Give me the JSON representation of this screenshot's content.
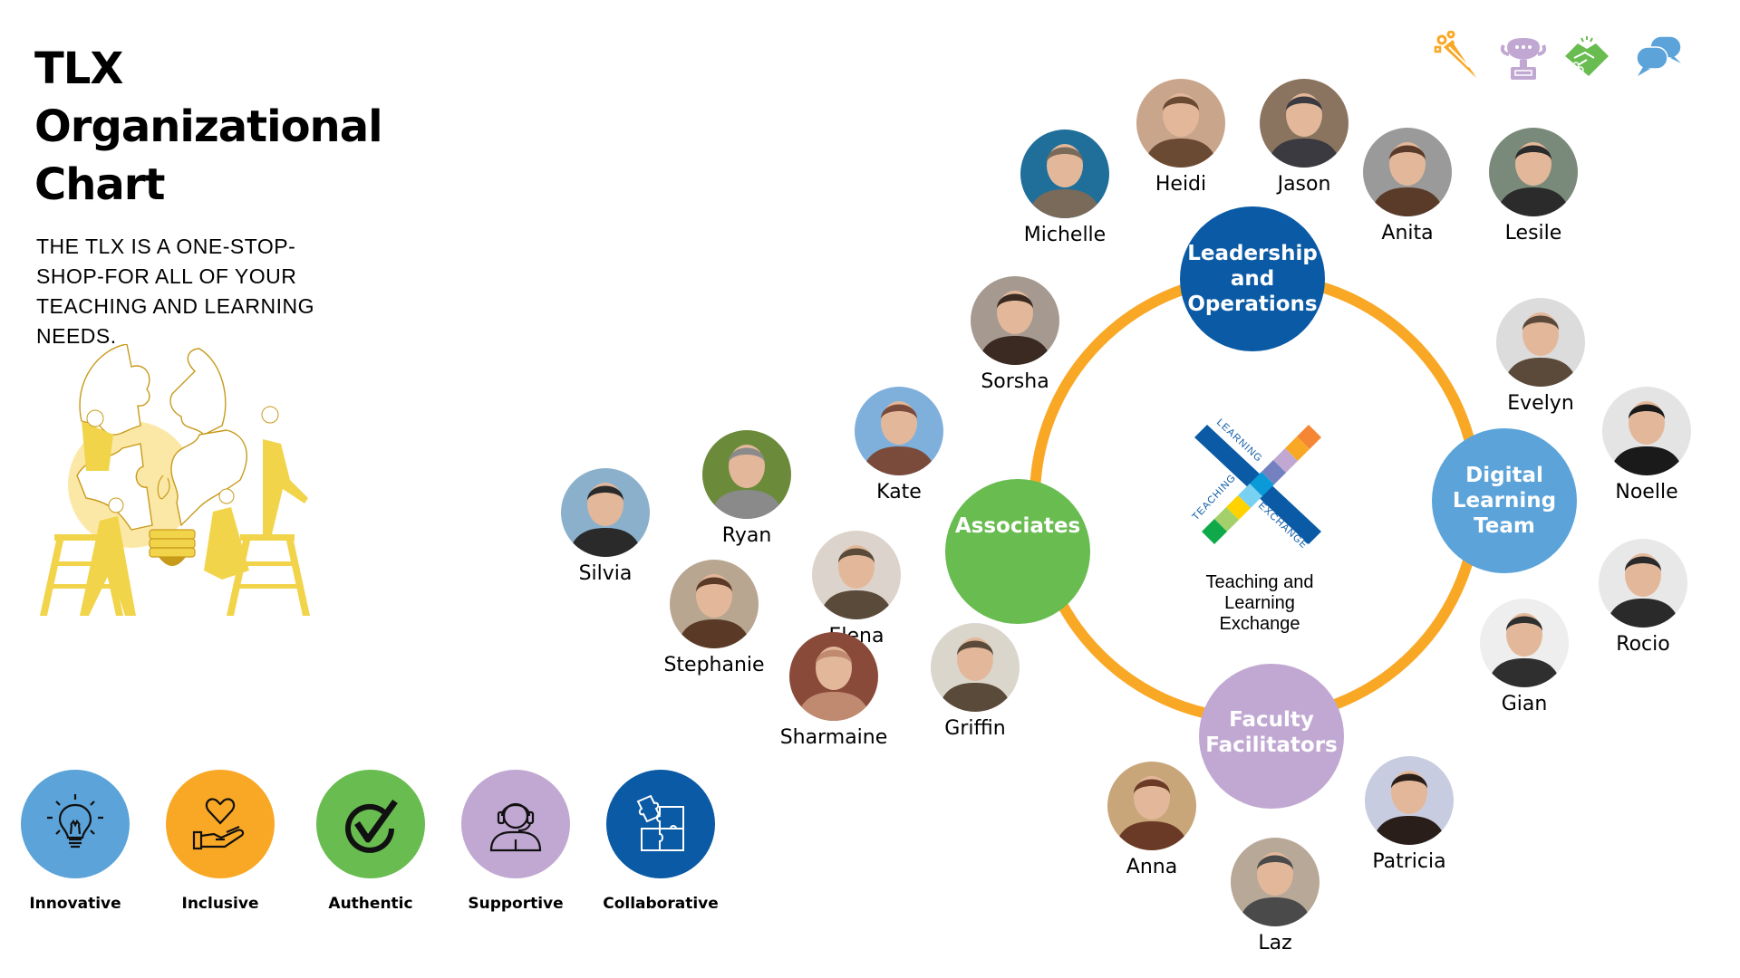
{
  "header": {
    "title_lines": [
      "TLX",
      "Organizational",
      "Chart"
    ],
    "tagline": "THE TLX IS A ONE-STOP-SHOP-FOR ALL OF YOUR TEACHING AND LEARNING NEEDS."
  },
  "top_icons": [
    {
      "name": "party-popper-icon",
      "color": "#F9A826"
    },
    {
      "name": "trophy-icon",
      "color": "#C1A8D2"
    },
    {
      "name": "handshake-icon",
      "color": "#68BC50"
    },
    {
      "name": "chat-bubbles-icon",
      "color": "#5BA3D9"
    }
  ],
  "center": {
    "logo_words": {
      "top": "LEARNING",
      "left": "TEACHING",
      "right": "EXCHANGE"
    },
    "caption_lines": [
      "Teaching and",
      "Learning",
      "Exchange"
    ],
    "ring_color": "#F9A826"
  },
  "groups": [
    {
      "id": "leadership",
      "lines": [
        "Leadership",
        "and",
        "Operations"
      ],
      "color": "#0A5AA5"
    },
    {
      "id": "digital",
      "lines": [
        "Digital",
        "Learning",
        "Team"
      ],
      "color": "#5BA3D9"
    },
    {
      "id": "faculty",
      "lines": [
        "Faculty",
        "Facilitators"
      ],
      "color": "#C1A8D2"
    },
    {
      "id": "associates",
      "lines": [
        "Associates"
      ],
      "color": "#68BC50"
    }
  ],
  "people": [
    {
      "name": "Michelle",
      "group": "leadership"
    },
    {
      "name": "Heidi",
      "group": "leadership"
    },
    {
      "name": "Jason",
      "group": "leadership"
    },
    {
      "name": "Anita",
      "group": "leadership"
    },
    {
      "name": "Lesile",
      "group": "leadership"
    },
    {
      "name": "Evelyn",
      "group": "digital"
    },
    {
      "name": "Noelle",
      "group": "digital"
    },
    {
      "name": "Rocio",
      "group": "digital"
    },
    {
      "name": "Gian",
      "group": "digital"
    },
    {
      "name": "Anna",
      "group": "faculty"
    },
    {
      "name": "Laz",
      "group": "faculty"
    },
    {
      "name": "Patricia",
      "group": "faculty"
    },
    {
      "name": "Sorsha",
      "group": "associates"
    },
    {
      "name": "Kate",
      "group": "associates"
    },
    {
      "name": "Ryan",
      "group": "associates"
    },
    {
      "name": "Silvia",
      "group": "associates"
    },
    {
      "name": "Elena",
      "group": "associates"
    },
    {
      "name": "Stephanie",
      "group": "associates"
    },
    {
      "name": "Sharmaine",
      "group": "associates"
    },
    {
      "name": "Griffin",
      "group": "associates"
    }
  ],
  "values": [
    {
      "label": "Innovative",
      "icon": "lightbulb-icon",
      "color": "#5BA3D9"
    },
    {
      "label": "Inclusive",
      "icon": "heart-in-hand-icon",
      "color": "#F9A826"
    },
    {
      "label": "Authentic",
      "icon": "checkmark-circle-icon",
      "color": "#68BC50"
    },
    {
      "label": "Supportive",
      "icon": "headset-person-icon",
      "color": "#C1A8D2"
    },
    {
      "label": "Collaborative",
      "icon": "puzzle-icon",
      "color": "#0A5AA5"
    }
  ]
}
